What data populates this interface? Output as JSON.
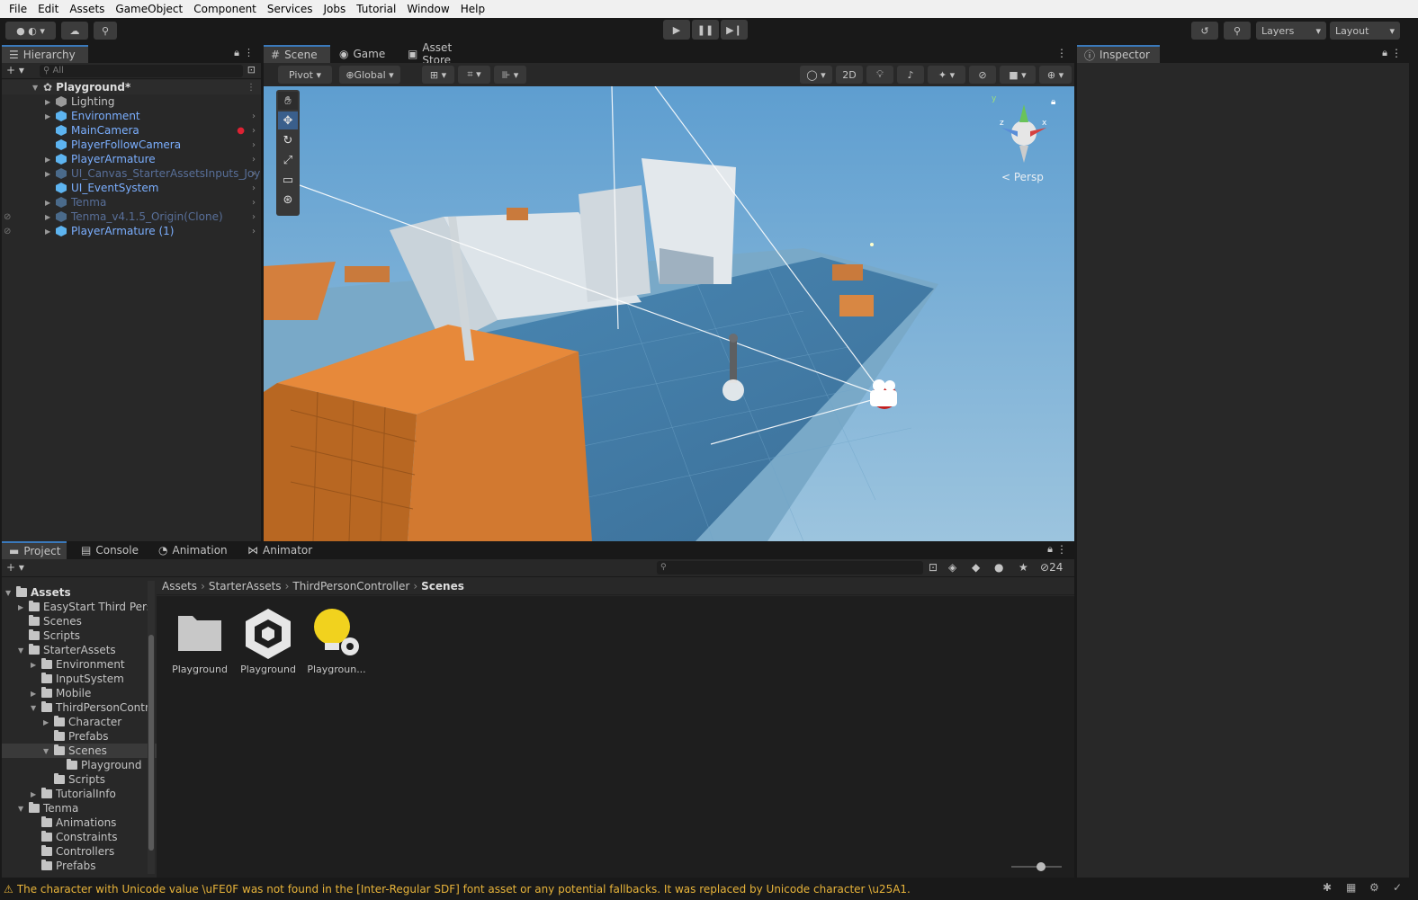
{
  "menu": [
    "File",
    "Edit",
    "Assets",
    "GameObject",
    "Component",
    "Services",
    "Jobs",
    "Tutorial",
    "Window",
    "Help"
  ],
  "toolbar": {
    "layers_label": "Layers",
    "layout_label": "Layout"
  },
  "hierarchy": {
    "tab_label": "Hierarchy",
    "search_placeholder": "All",
    "scene_name": "Playground*",
    "items": [
      {
        "label": "Lighting"
      },
      {
        "label": "Environment"
      },
      {
        "label": "MainCamera"
      },
      {
        "label": "PlayerFollowCamera"
      },
      {
        "label": "PlayerArmature"
      },
      {
        "label": "UI_Canvas_StarterAssetsInputs_Joy"
      },
      {
        "label": "UI_EventSystem"
      },
      {
        "label": "Tenma"
      },
      {
        "label": "Tenma_v4.1.5_Origin(Clone)"
      },
      {
        "label": "PlayerArmature (1)"
      }
    ]
  },
  "scene_tabs": {
    "scene": "Scene",
    "game": "Game",
    "asset_store": "Asset Store"
  },
  "scene_toolbar": {
    "pivot": "Pivot",
    "global": "Global",
    "mode_2d": "2D"
  },
  "scene_view": {
    "persp_label": "< Persp",
    "axis_y": "y",
    "axis_x": "x",
    "axis_z": "z"
  },
  "inspector": {
    "tab_label": "Inspector"
  },
  "bottom_tabs": {
    "project": "Project",
    "console": "Console",
    "animation": "Animation",
    "animator": "Animator"
  },
  "project": {
    "hidden_count": "24",
    "breadcrumb": [
      "Assets",
      "StarterAssets",
      "ThirdPersonController",
      "Scenes"
    ],
    "tree": [
      {
        "label": "Assets",
        "bold": true
      },
      {
        "label": "EasyStart Third Pers"
      },
      {
        "label": "Scenes"
      },
      {
        "label": "Scripts"
      },
      {
        "label": "StarterAssets"
      },
      {
        "label": "Environment"
      },
      {
        "label": "InputSystem"
      },
      {
        "label": "Mobile"
      },
      {
        "label": "ThirdPersonContr"
      },
      {
        "label": "Character"
      },
      {
        "label": "Prefabs"
      },
      {
        "label": "Scenes"
      },
      {
        "label": "Playground"
      },
      {
        "label": "Scripts"
      },
      {
        "label": "TutorialInfo"
      },
      {
        "label": "Tenma"
      },
      {
        "label": "Animations"
      },
      {
        "label": "Constraints"
      },
      {
        "label": "Controllers"
      },
      {
        "label": "Prefabs"
      }
    ],
    "assets": [
      {
        "label": "Playground",
        "kind": "folder"
      },
      {
        "label": "Playground",
        "kind": "scene"
      },
      {
        "label": "Playgroun...",
        "kind": "lighting"
      }
    ]
  },
  "status_bar": {
    "message": "The character with Unicode value \\uFE0F was not found in the [Inter-Regular SDF] font asset or any potential fallbacks. It was replaced by Unicode character \\u25A1."
  },
  "colors": {
    "accent": "#3a79bb",
    "hierarchy_blue": "#7bafff",
    "warning": "#e8b43a",
    "orange_block": "#e0852f",
    "sky": "#7fb4d6"
  }
}
